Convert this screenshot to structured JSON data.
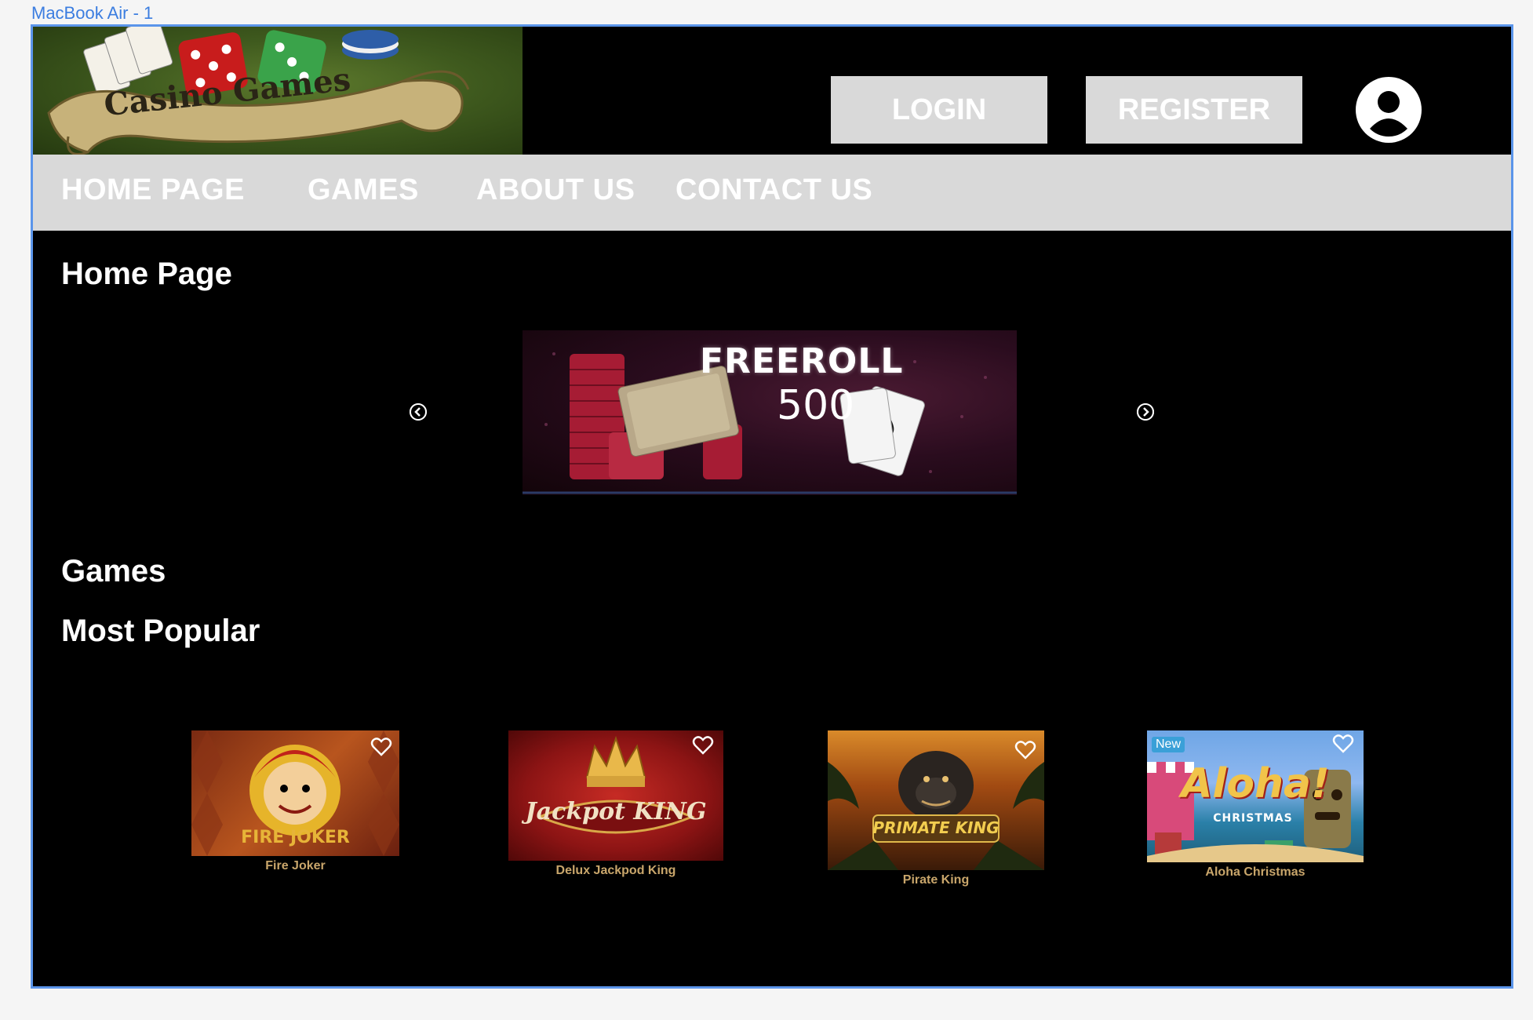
{
  "canvas": {
    "frame_label": "MacBook Air - 1"
  },
  "header": {
    "logo_text": "Casino Games",
    "login_label": "LOGIN",
    "register_label": "REGISTER",
    "avatar_icon": "user-circle-icon"
  },
  "nav": {
    "items": [
      {
        "label": "HOME PAGE"
      },
      {
        "label": "GAMES"
      },
      {
        "label": "ABOUT US"
      },
      {
        "label": "CONTACT US"
      }
    ]
  },
  "main": {
    "page_title": "Home Page",
    "carousel": {
      "prev_icon": "chevron-left-icon",
      "next_icon": "chevron-right-icon",
      "banner": {
        "title": "FREEROLL",
        "amount": "500"
      }
    },
    "games_heading": "Games",
    "most_popular_heading": "Most Popular",
    "games": [
      {
        "name": "Fire Joker",
        "thumb_text": "FIRE JOKER",
        "favorite_icon": "heart-icon"
      },
      {
        "name": "Delux Jackpod King",
        "thumb_text": "Jackpot KING",
        "favorite_icon": "heart-icon"
      },
      {
        "name": "Pirate King",
        "thumb_text": "PRIMATE KING",
        "favorite_icon": "heart-icon"
      },
      {
        "name": "Aloha Christmas",
        "thumb_text": "Aloha!",
        "thumb_subtext": "CHRISTMAS",
        "badge": "New",
        "favorite_icon": "heart-icon"
      }
    ]
  },
  "colors": {
    "frame_border": "#5b95ea",
    "frame_label": "#3b7de0",
    "background": "#000000",
    "nav_background": "#d9d9d9",
    "button_background": "#d9d9d9",
    "caption": "#c9a66b"
  }
}
